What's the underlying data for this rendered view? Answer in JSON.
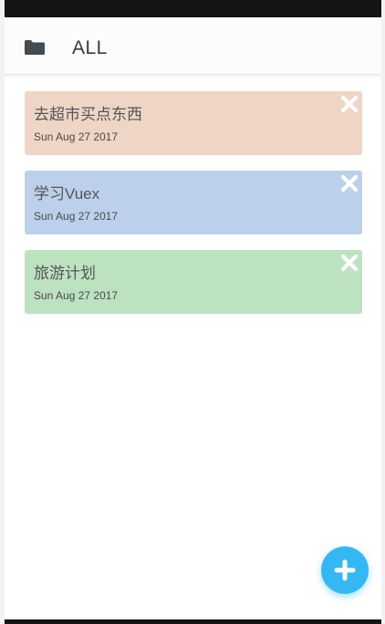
{
  "header": {
    "title": "ALL",
    "icon": "folder-icon"
  },
  "notes": [
    {
      "title": "去超市买点东西",
      "date": "Sun Aug 27 2017",
      "color": "#eed5c6"
    },
    {
      "title": "学习Vuex",
      "date": "Sun Aug 27 2017",
      "color": "#bcd0eb"
    },
    {
      "title": "旅游计划",
      "date": "Sun Aug 27 2017",
      "color": "#bde2c0"
    }
  ],
  "actions": {
    "delete_icon": "close-icon",
    "add_icon": "plus-icon"
  },
  "colors": {
    "accent": "#33b8f4",
    "status_bar": "#141414"
  }
}
